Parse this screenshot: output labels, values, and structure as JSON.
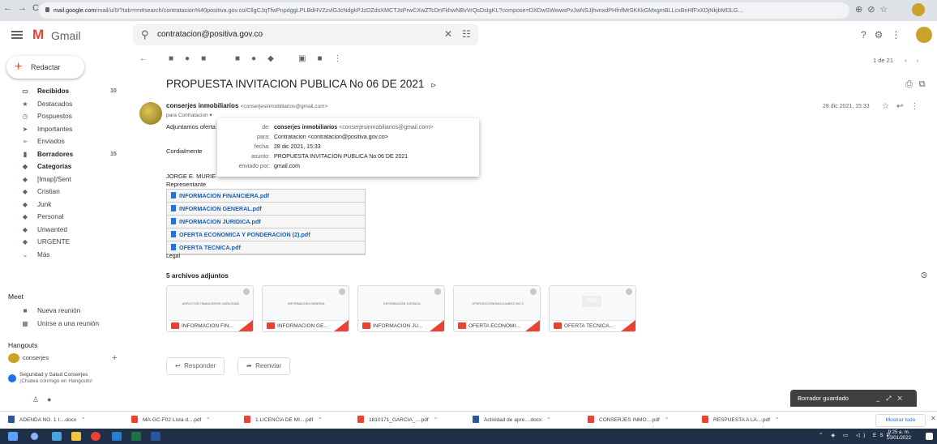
{
  "browser": {
    "url_prefix": "mail.google.com",
    "url_rest": "/mail/u/0/?tab=rm#search/contratacion%40positiva.gov.co/CllgCJqTfwPnpdggLPLBdHVZzvlGJcNdgkPJzDZdsXMCTJsPrwCXwZTcDnFkhwNBvVrQsDsIgKL?compose=DXDwSWwwsPvJwNSJjhvnxdPHfnfMrSKKkGMxgmBLLcxBnHfFxXDjNkjbMDLG..."
  },
  "gmail": {
    "logo_mark": "M",
    "logo_text": "Gmail",
    "search_value": "contratacion@positiva.gov.co",
    "compose_label": "Redactar"
  },
  "sidebar": {
    "items": [
      {
        "icon": "inbox-icon",
        "glyph": "▭",
        "label": "Recibidos",
        "count": "10",
        "bold": true
      },
      {
        "icon": "star-icon",
        "glyph": "★",
        "label": "Destacados",
        "count": ""
      },
      {
        "icon": "snooze-icon",
        "glyph": "◷",
        "label": "Pospuestos",
        "count": ""
      },
      {
        "icon": "important-icon",
        "glyph": "➤",
        "label": "Importantes",
        "count": ""
      },
      {
        "icon": "sent-icon",
        "glyph": "➢",
        "label": "Enviados",
        "count": ""
      },
      {
        "icon": "draft-icon",
        "glyph": "▮",
        "label": "Borradores",
        "count": "15",
        "bold": true
      },
      {
        "icon": "label-icon",
        "glyph": "◆",
        "label": "Categorías",
        "count": "",
        "bold": true
      },
      {
        "icon": "label-icon",
        "glyph": "◆",
        "label": "[Imap]/Sent",
        "count": ""
      },
      {
        "icon": "label-icon",
        "glyph": "◆",
        "label": "Cristian",
        "count": ""
      },
      {
        "icon": "label-icon",
        "glyph": "◆",
        "label": "Junk",
        "count": ""
      },
      {
        "icon": "label-icon",
        "glyph": "◆",
        "label": "Personal",
        "count": ""
      },
      {
        "icon": "label-icon",
        "glyph": "◆",
        "label": "Unwanted",
        "count": ""
      },
      {
        "icon": "label-icon",
        "glyph": "◆",
        "label": "URGENTE",
        "count": ""
      },
      {
        "icon": "expand-icon",
        "glyph": "⌄",
        "label": "Más",
        "count": ""
      }
    ],
    "meet_title": "Meet",
    "meet_new": "Nueva reunión",
    "meet_join": "Unirse a una reunión",
    "hangouts_title": "Hangouts",
    "hangouts_user": "conserjes",
    "hangouts_chat_name": "Seguridad y Salud Conserjes",
    "hangouts_chat_msg": "¡Chatea conmigo en Hangouts!"
  },
  "toolbar": {
    "pagination": "1 de 21"
  },
  "email": {
    "subject": "PROPUESTA INVITACION PUBLICA No 06 DE 2021",
    "sender_name": "conserjes inmobiliarios",
    "sender_email": "<conserjesinmobiliarios@gmail.com>",
    "recipient": "para Contratacion",
    "date": "28 dic 2021, 15:33",
    "body_line1": "Adjuntamos oferta",
    "body_line2": "Cordialmente",
    "body_line3": "JORGE E. MURIE",
    "body_line4": "Representante",
    "body_legal": "Legal",
    "files": [
      "INFORMACION FINANCIERA.pdf",
      "INFORMACION GENERAL.pdf",
      "INFORMACION JURIDICA.pdf",
      "OFERTA ECONOMICA Y PONDERACION (2).pdf",
      "OFERTA TECNICA.pdf"
    ],
    "attachments_header": "5 archivos adjuntos",
    "attachments": [
      {
        "label": "INFORMACION FIN...",
        "preview": "ASPECTOS FINANCIEROS CAPACIDAD"
      },
      {
        "label": "INFORMACION GE...",
        "preview": "INFORMACION GENERAL"
      },
      {
        "label": "INFORMACION JU...",
        "preview": "INFORMACION JURIDICA"
      },
      {
        "label": "OFERTA ECONOMI...",
        "preview": "OFERTA ECONOMICA ANEXO NO 3"
      },
      {
        "label": "OFERTA TECNICA...",
        "preview": "PDF"
      }
    ],
    "reply_label": "Responder",
    "forward_label": "Reenviar"
  },
  "details": {
    "de_key": "de:",
    "de_name": "conserjes inmobiliarios",
    "de_email": "<conserjesinmobiliarios@gmail.com>",
    "para_key": "para:",
    "para_val": "Contratacion <contratacion@positiva.gov.co>",
    "fecha_key": "fecha:",
    "fecha_val": "28 dic 2021, 15:33",
    "asunto_key": "asunto:",
    "asunto_val": "PROPUESTA INVITACION PUBLICA No 06 DE 2021",
    "enviado_key": "enviado por:",
    "enviado_val": "gmail.com"
  },
  "draft_saved": "Borrador guardado",
  "downloads": [
    {
      "label": "ADENDA NO. 1 I....docx",
      "type": "docx"
    },
    {
      "label": "MA-GC-F02 Lista d....pdf",
      "type": "pdf"
    },
    {
      "label": "1.LICENCIA DE MI....pdf",
      "type": "pdf"
    },
    {
      "label": "1810171_GARCIA_....pdf",
      "type": "pdf"
    },
    {
      "label": "Actividad de apre....docx",
      "type": "docx"
    },
    {
      "label": "CONSERJES INMO....pdf",
      "type": "pdf"
    },
    {
      "label": "RESPUESTA A LA....pdf",
      "type": "pdf"
    }
  ],
  "show_all": "Mostrar todo",
  "taskbar": {
    "lang": "ESP",
    "time": "9:25 a. m.",
    "date": "10/01/2022"
  },
  "colors": {
    "gmail_red": "#ea4335",
    "link_blue": "#1a5fb4",
    "taskbar": "#1f3148"
  }
}
